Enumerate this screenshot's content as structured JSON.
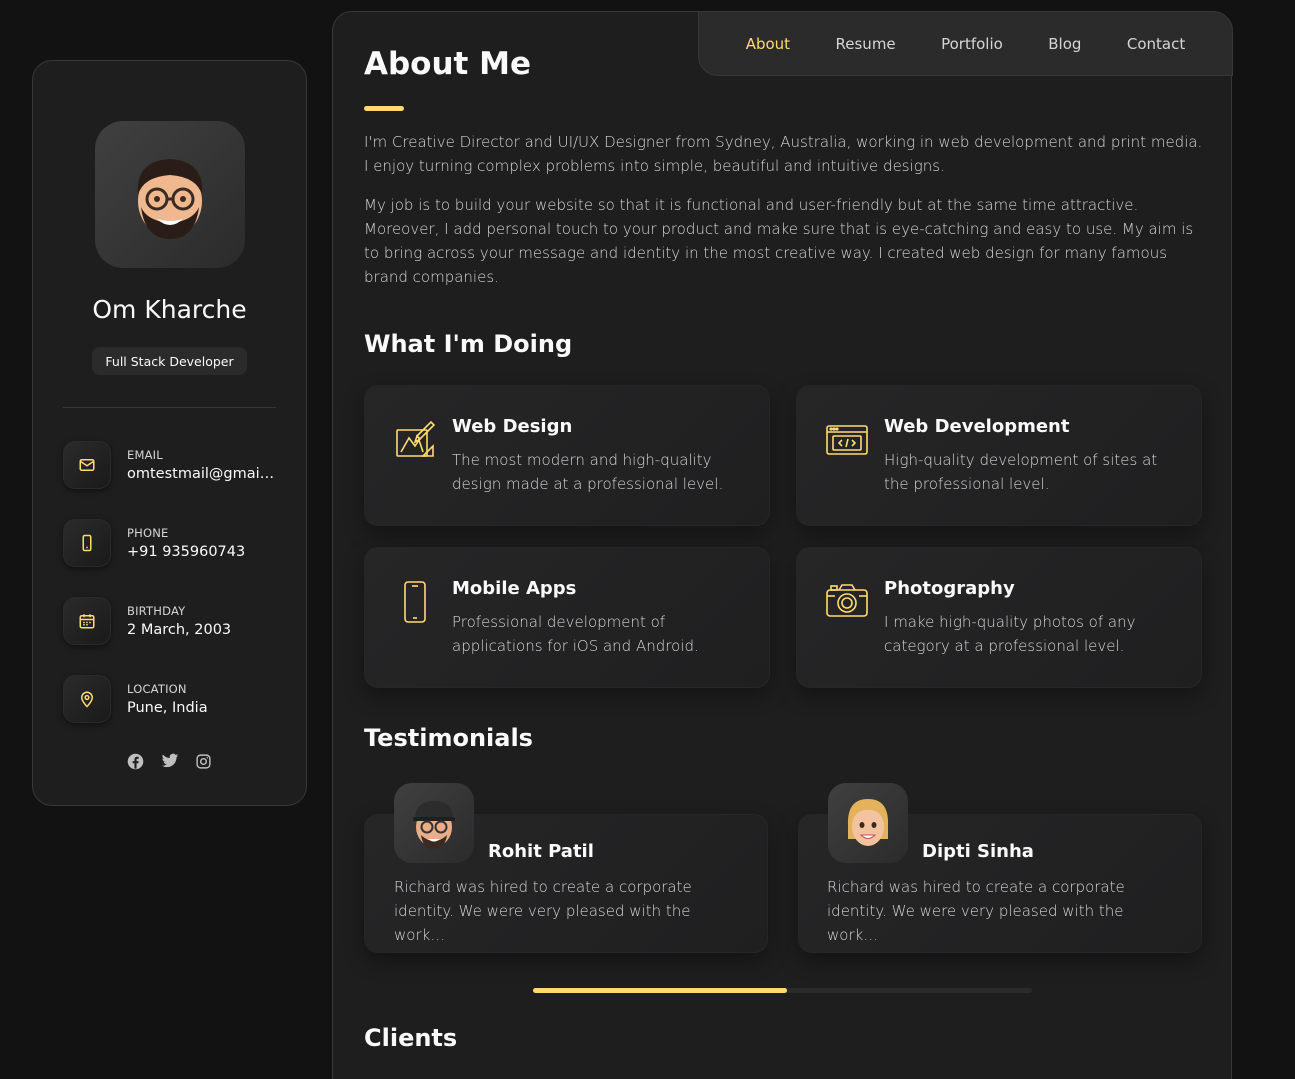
{
  "profile": {
    "name": "Om Kharche",
    "title": "Full Stack Developer",
    "contacts": [
      {
        "label": "Email",
        "value": "omtestmail@gmail.com",
        "icon": "mail-icon"
      },
      {
        "label": "Phone",
        "value": "+91 935960743",
        "icon": "phone-icon"
      },
      {
        "label": "Birthday",
        "value": "2 March, 2003",
        "icon": "calendar-icon"
      },
      {
        "label": "Location",
        "value": "Pune, India",
        "icon": "location-pin-icon"
      }
    ],
    "socials": [
      "facebook-icon",
      "twitter-icon",
      "instagram-icon"
    ]
  },
  "nav": {
    "items": [
      {
        "label": "About",
        "active": true
      },
      {
        "label": "Resume",
        "active": false
      },
      {
        "label": "Portfolio",
        "active": false
      },
      {
        "label": "Blog",
        "active": false
      },
      {
        "label": "Contact",
        "active": false
      }
    ]
  },
  "about": {
    "heading": "About Me",
    "paragraphs": [
      "I'm Creative Director and UI/UX Designer from Sydney, Australia, working in web development and print media. I enjoy turning complex problems into simple, beautiful and intuitive designs.",
      "My job is to build your website so that it is functional and user-friendly but at the same time attractive. Moreover, I add personal touch to your product and make sure that is eye-catching and easy to use. My aim is to bring across your message and identity in the most creative way. I created web design for many famous brand companies."
    ]
  },
  "services": {
    "heading": "What I'm Doing",
    "items": [
      {
        "title": "Web Design",
        "text": "The most modern and high-quality design made at a professional level.",
        "icon": "design-icon"
      },
      {
        "title": "Web Development",
        "text": "High-quality development of sites at the professional level.",
        "icon": "code-icon"
      },
      {
        "title": "Mobile Apps",
        "text": "Professional development of applications for iOS and Android.",
        "icon": "mobile-icon"
      },
      {
        "title": "Photography",
        "text": "I make high-quality photos of any category at a professional level.",
        "icon": "camera-icon"
      }
    ]
  },
  "testimonials": {
    "heading": "Testimonials",
    "items": [
      {
        "name": "Rohit Patil",
        "text": "Richard was hired to create a corporate identity. We were very pleased with the work…"
      },
      {
        "name": "Dipti Sinha",
        "text": "Richard was hired to create a corporate identity. We were very pleased with the work…"
      }
    ],
    "scroll_progress": 0.51
  },
  "clients": {
    "heading": "Clients"
  },
  "colors": {
    "accent": "#ffdb70",
    "background": "#121212",
    "card": "#1e1e1f"
  }
}
